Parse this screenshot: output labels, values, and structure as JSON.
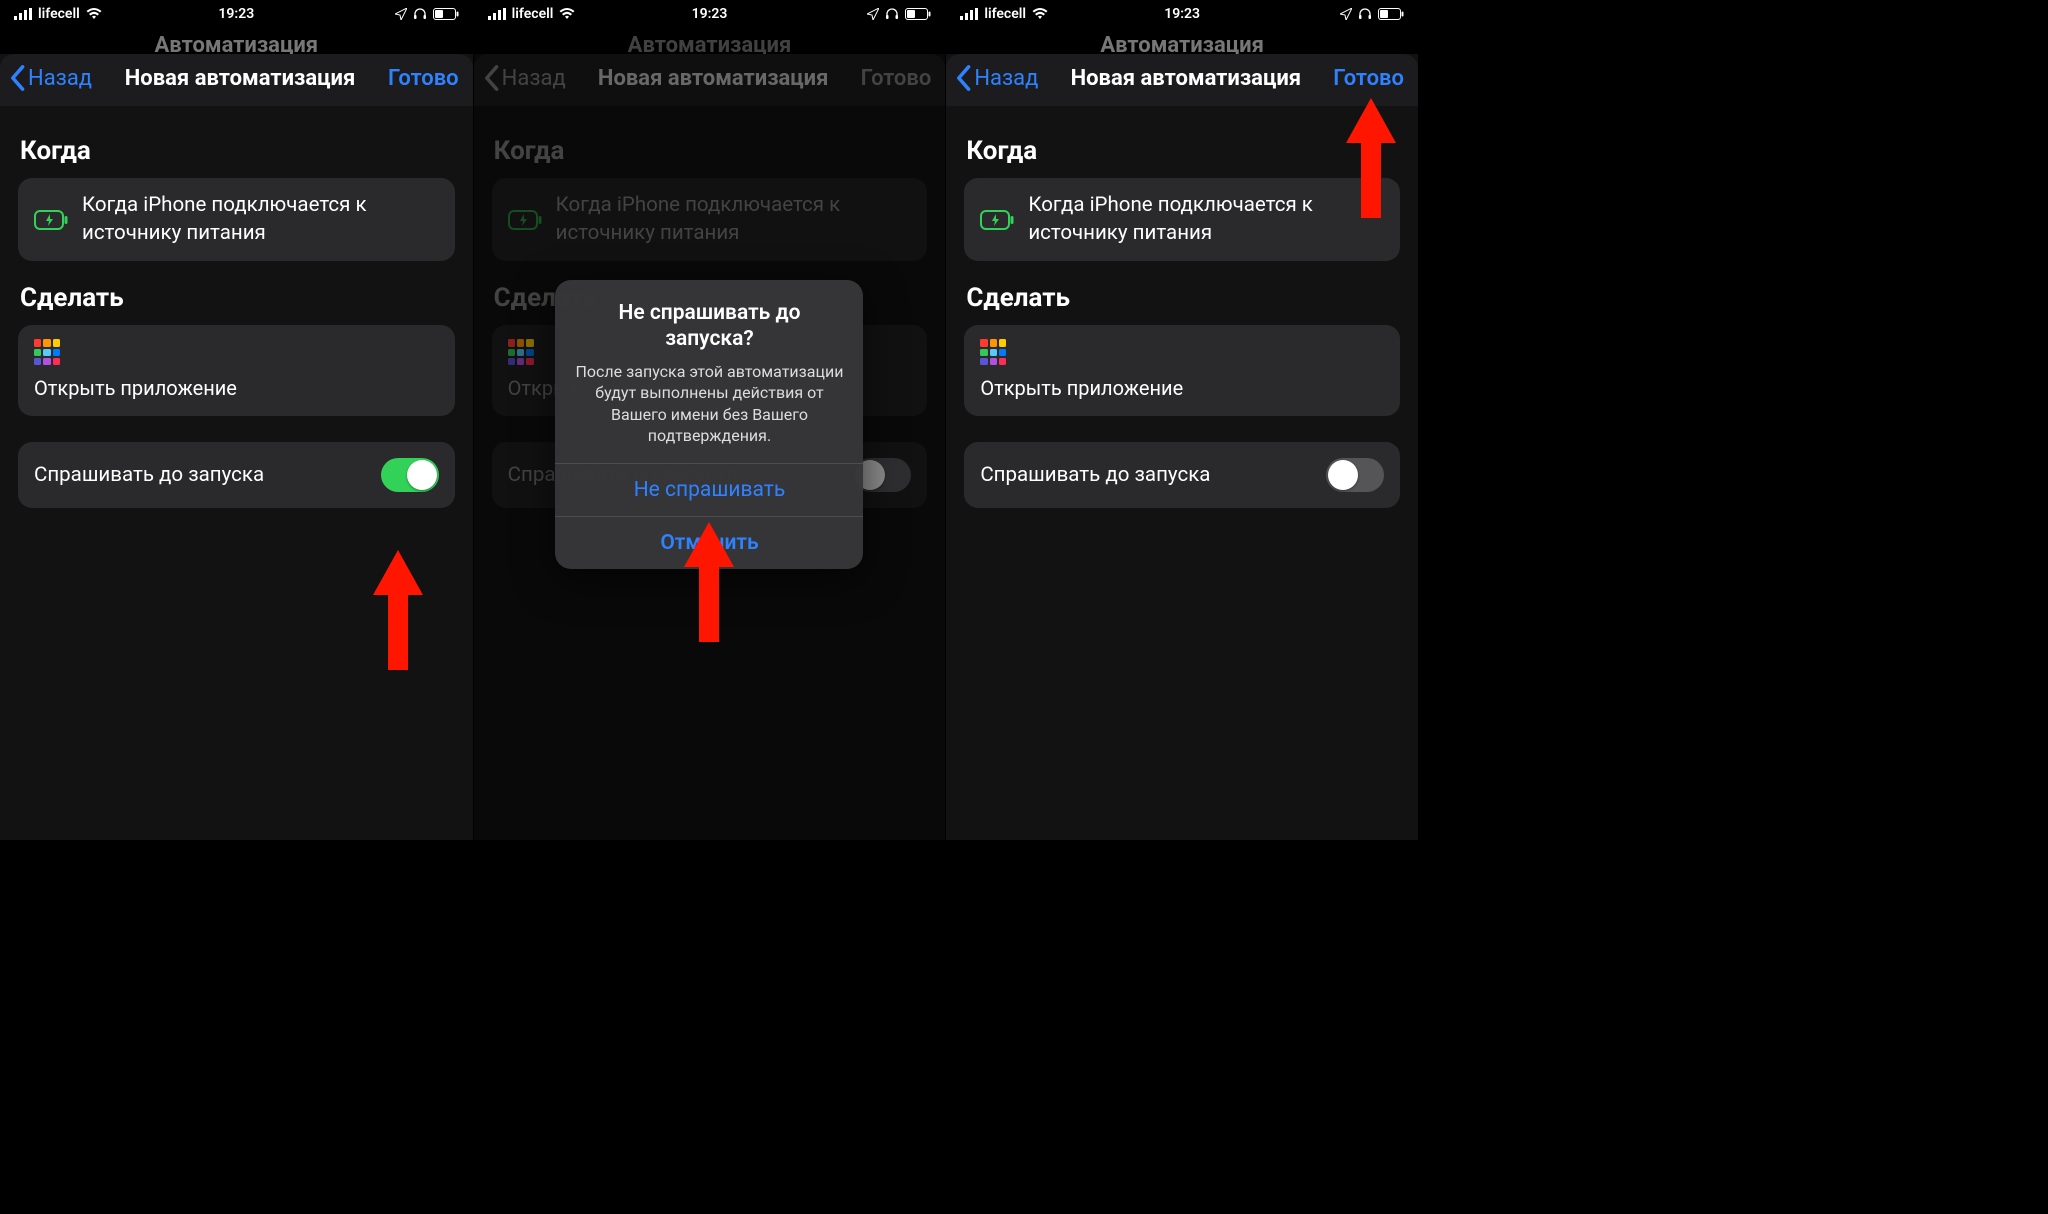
{
  "status": {
    "carrier": "lifecell",
    "time": "19:23"
  },
  "sheet_peek": "Автоматизация",
  "nav": {
    "back": "Назад",
    "title": "Новая автоматизация",
    "done": "Готово"
  },
  "sections": {
    "when": "Когда",
    "do": "Сделать"
  },
  "when_card": "Когда iPhone подключается к источнику питания",
  "do_card": "Открыть приложение",
  "toggle_label": "Спрашивать до запуска",
  "alert": {
    "title": "Не спрашивать до запуска?",
    "message": "После запуска этой автоматизации будут выполнены действия от Вашего имени без Вашего подтверждения.",
    "confirm": "Не спрашивать",
    "cancel": "Отменить"
  },
  "app_grid_colors": [
    "#ff3b30",
    "#ff9500",
    "#ffcc00",
    "#34c759",
    "#5ac8fa",
    "#007aff",
    "#5856d6",
    "#af52de",
    "#ff2d55"
  ]
}
